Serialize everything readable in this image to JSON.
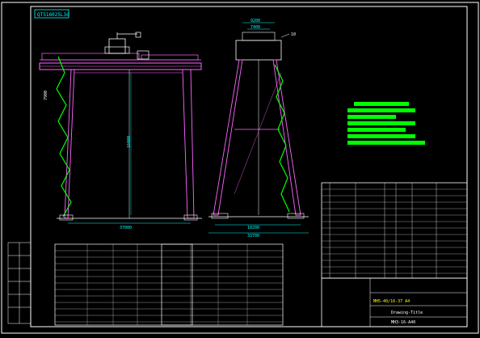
{
  "title_box": "QTS16025L3d",
  "dim_span": "37000",
  "dim_height": "16000",
  "dim_top_width": "9200",
  "dim_top_inner": "7400",
  "dim_base_width": "33700",
  "dim_base_inner": "10200",
  "dim_left_side": "7900",
  "leader_tag": "10",
  "title_block": {
    "line1": "MH5-40/16-37 A4",
    "line2": "Drawing-Title",
    "line3": "MH3-16-A40"
  },
  "colors": {
    "frame": "#ffffff",
    "structure": "#ff66ff",
    "rail": "#00ff00",
    "dimension": "#00ffff",
    "text": "#ffffff",
    "highlight": "#00ff00",
    "accent": "#ffff00"
  }
}
